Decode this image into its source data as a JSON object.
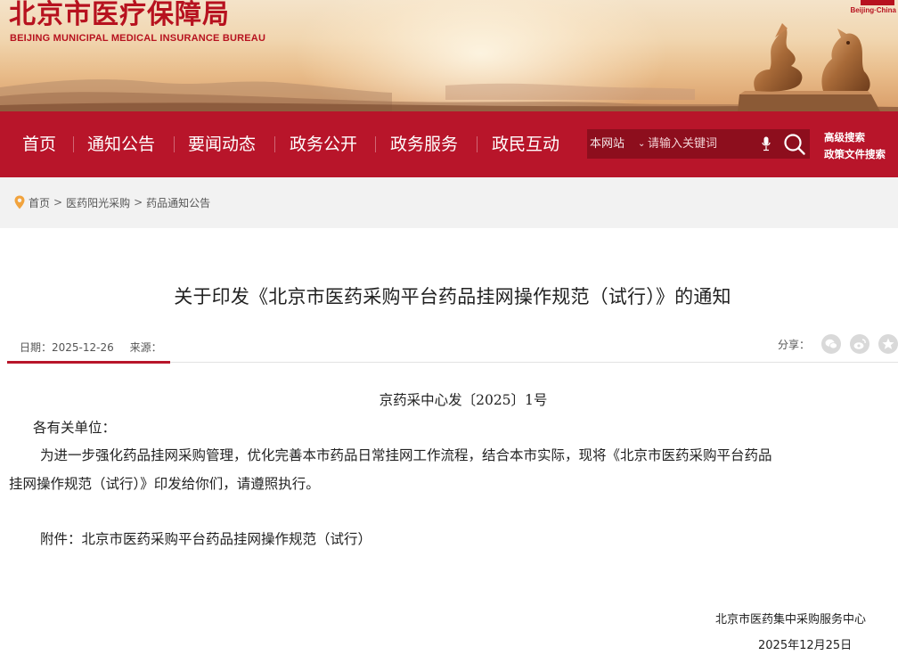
{
  "header": {
    "logo_cn": "北京市医疗保障局",
    "logo_en": "BEIJING MUNICIPAL MEDICAL INSURANCE BUREAU",
    "corner_tag": "Beijing·China",
    "statue_icon": "bronze-statue-icon"
  },
  "nav": {
    "items": [
      "首页",
      "通知公告",
      "要闻动态",
      "政务公开",
      "政务服务",
      "政民互动"
    ],
    "search_scope": "本网站",
    "search_placeholder": "请输入关键词",
    "advanced_search": "高级搜索",
    "policy_search": "政策文件搜索"
  },
  "breadcrumb": [
    "首页",
    "医药阳光采购",
    "药品通知公告"
  ],
  "article": {
    "title": "关于印发《北京市医药采购平台药品挂网操作规范（试行）》的通知",
    "date": "日期：2025-12-26",
    "source": "来源：",
    "share_label": "分享：",
    "share_icons": [
      "wechat-icon",
      "weibo-icon",
      "star-icon"
    ],
    "doc_number": "京药采中心发〔2025〕1号",
    "salutation": "各有关单位：",
    "body_line1": "为进一步强化药品挂网采购管理，优化完善本市药品日常挂网工作流程，结合本市实际，现将《北京市医药采购平台药品",
    "body_line2": "挂网操作规范（试行）》印发给你们，请遵照执行。",
    "attachment": "附件：北京市医药采购平台药品挂网操作规范（试行）",
    "signature_org": "北京市医药集中采购服务中心",
    "signature_date": "2025年12月25日"
  },
  "colors": {
    "brand_red": "#b8152a",
    "search_bg": "#8d0e1d",
    "breadcrumb_bg": "#f2f2f2"
  }
}
